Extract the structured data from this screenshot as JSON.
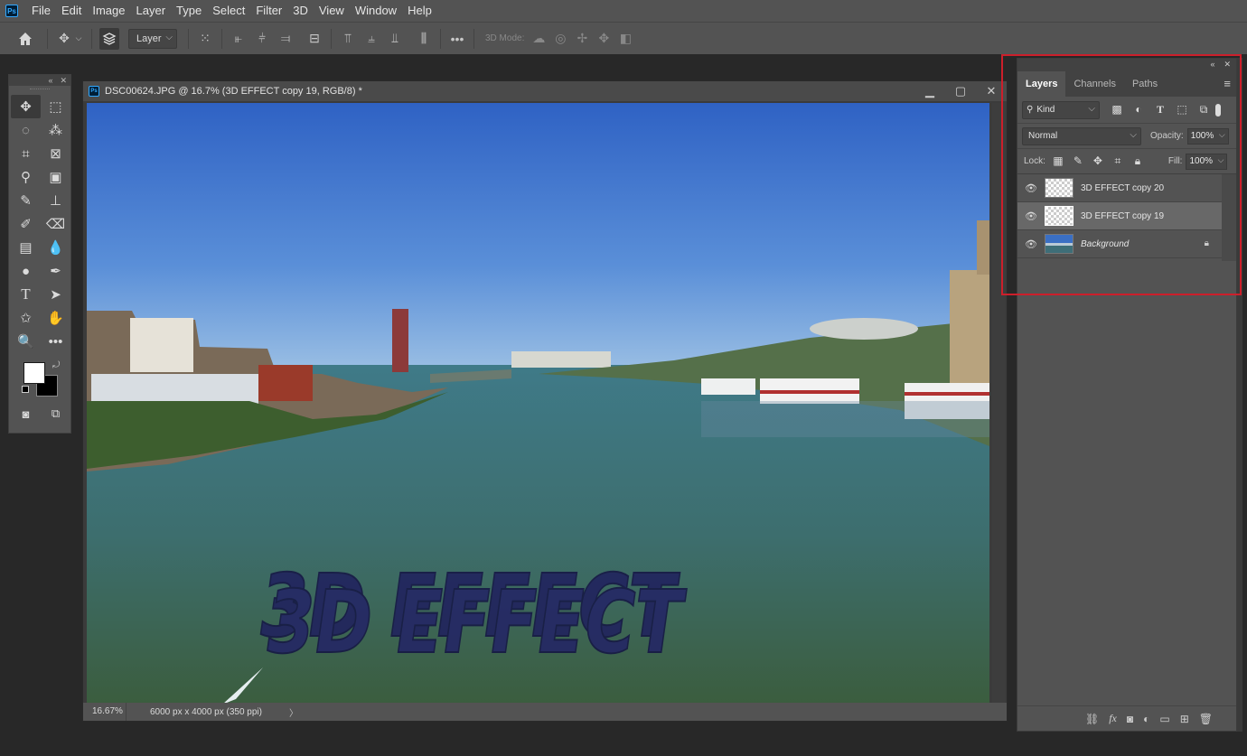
{
  "menu": [
    "File",
    "Edit",
    "Image",
    "Layer",
    "Type",
    "Select",
    "Filter",
    "3D",
    "View",
    "Window",
    "Help"
  ],
  "app_logo": "Ps",
  "options_bar": {
    "auto_select_target": "Layer",
    "mode_3d_label": "3D Mode:",
    "more_label": "•••"
  },
  "document": {
    "title": "DSC00624.JPG @ 16.7% (3D EFFECT copy 19, RGB/8) *",
    "zoom": "16.67%",
    "dimensions": "6000 px x 4000 px (350 ppi)",
    "canvas_text": "3D EFFECT"
  },
  "layers_panel": {
    "tabs": [
      "Layers",
      "Channels",
      "Paths"
    ],
    "active_tab": "Layers",
    "filter_kind": "Kind",
    "blend_mode": "Normal",
    "opacity_label": "Opacity:",
    "opacity_value": "100%",
    "lock_label": "Lock:",
    "fill_label": "Fill:",
    "fill_value": "100%",
    "layers": [
      {
        "name": "3D EFFECT copy 20",
        "visible": true,
        "selected": false,
        "locked": false
      },
      {
        "name": "3D EFFECT copy 19",
        "visible": true,
        "selected": true,
        "locked": false
      },
      {
        "name": "Background",
        "visible": true,
        "selected": false,
        "locked": true
      }
    ]
  },
  "colors": {
    "foreground": "#ffffff",
    "background": "#000000",
    "highlight": "#cc1f2b"
  }
}
